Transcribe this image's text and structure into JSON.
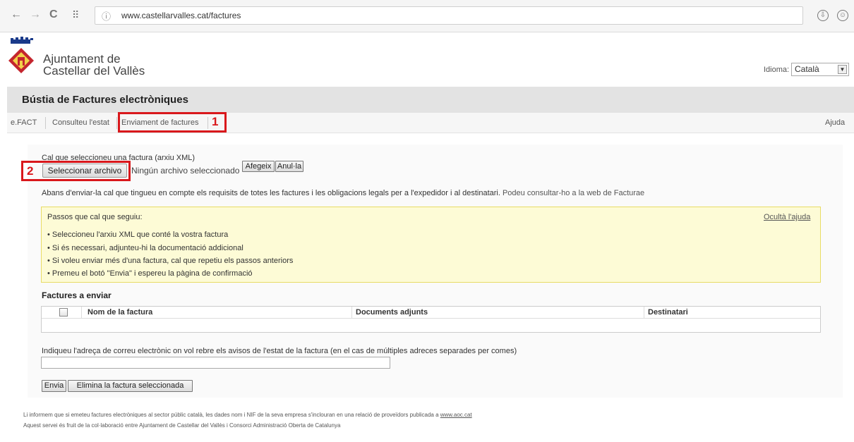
{
  "browser": {
    "url": "www.castellarvalles.cat/factures",
    "back_glyph": "←",
    "forward_glyph": "→",
    "reload_glyph": "C",
    "apps_glyph": "⠿",
    "site_glyph": "ⓘ",
    "download_glyph": "⇩",
    "user_glyph": "☺"
  },
  "header": {
    "org_line1": "Ajuntament de",
    "org_line2": "Castellar del Vallès",
    "lang_label": "Idioma:",
    "lang_selected": "Català",
    "lang_arrow": "▼"
  },
  "page": {
    "title": "Bústia de Factures electròniques"
  },
  "tabs": [
    {
      "label": "e.FACT"
    },
    {
      "label": "Consulteu l'estat"
    },
    {
      "label": "Enviament de factures"
    }
  ],
  "ajuda": "Ajuda",
  "markers": {
    "one": "1",
    "two": "2"
  },
  "form": {
    "select_label": "Cal que seleccioneu una factura (arxiu XML)",
    "file_button": "Seleccionar archivo",
    "no_file": "Ningún archivo seleccionado",
    "add_button": "Afegeix",
    "cancel_button": "Anul·la",
    "notice_text": "Abans d'enviar-la cal que tingueu en compte els requisits de totes les factures i les obligacions legals per a l'expedidor i al destinatari.",
    "notice_link": "Podeu consultar-ho a la web de Facturae"
  },
  "help": {
    "title": "Passos que cal que seguiu:",
    "hide_link": "Ocultà l'ajuda",
    "items": [
      "Seleccioneu l'arxiu XML que conté la vostra factura",
      "Si és necessari, adjunteu-hi la documentació addicional",
      "Si voleu enviar més d'una factura, cal que repetiu els passos anteriors",
      "Premeu el botó \"Envia\" i espereu la pàgina de confirmació"
    ]
  },
  "table": {
    "title": "Factures a enviar",
    "columns": [
      "Nom de la factura",
      "Documents adjunts",
      "Destinatari"
    ]
  },
  "email": {
    "label": "Indiqueu l'adreça de correu electrònic on vol rebre els avisos de l'estat de la factura (en el cas de múltiples adreces separades per comes)",
    "value": ""
  },
  "actions": {
    "send": "Envia",
    "delete": "Elimina la factura seleccionada"
  },
  "footer": {
    "line1": "Li informem que si emeteu factures electròniques al sector públic català, les dades nom i NIF de la seva empresa s'inclouran en una relació de proveïdors publicada a",
    "line1_link": "www.aoc.cat",
    "line2": "Aquest servei és fruit de la col·laboració entre Ajuntament de Castellar del Vallès i Consorci Administració Oberta de Catalunya"
  },
  "colors": {
    "marker_red": "#d9181c",
    "help_bg": "#fdfbd6",
    "help_border": "#e8dc65",
    "title_bar": "#e3e3e3"
  }
}
